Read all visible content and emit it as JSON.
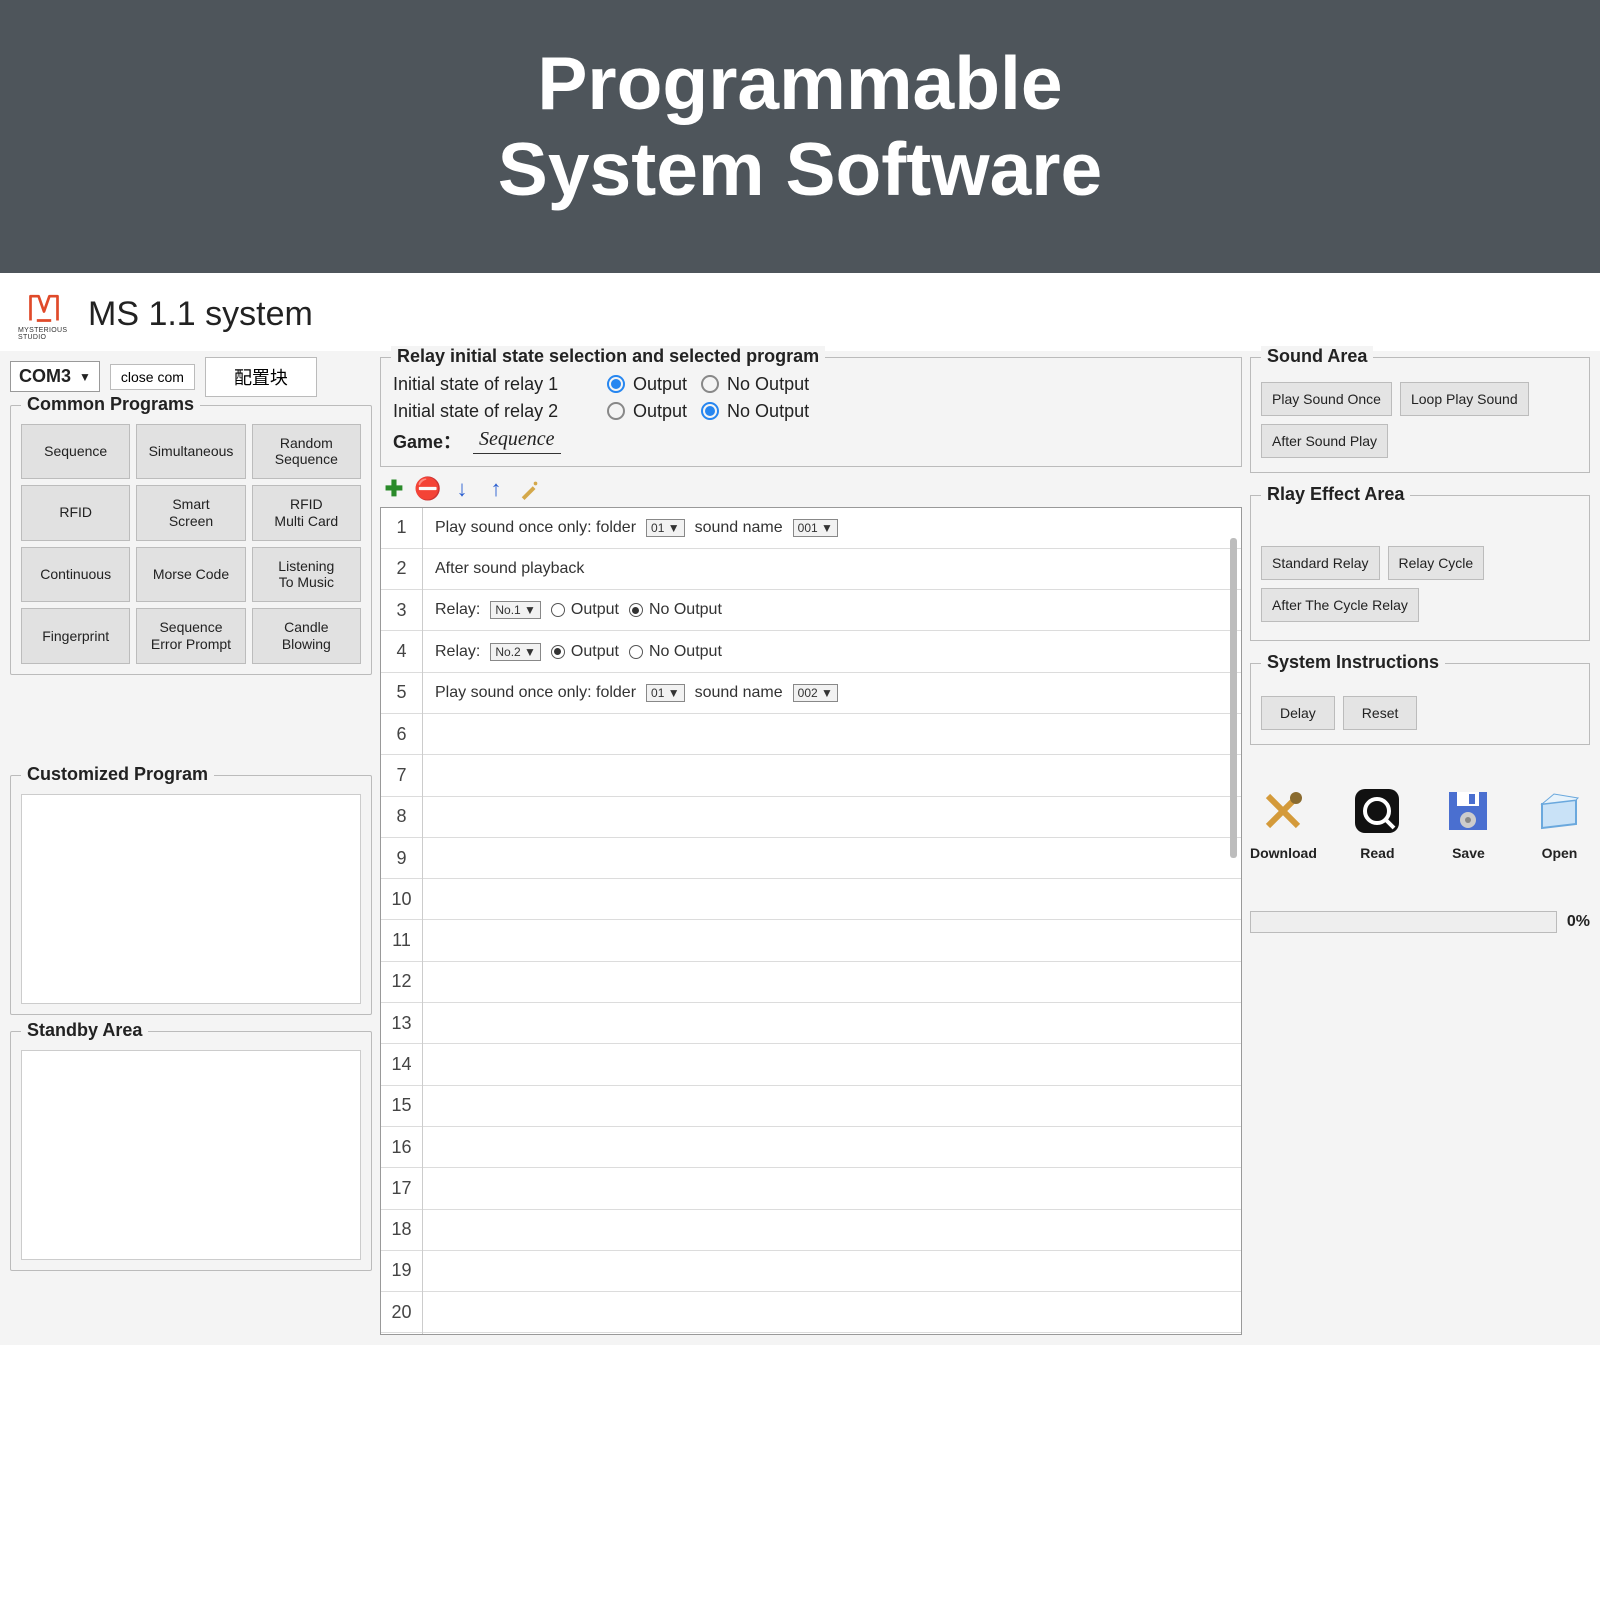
{
  "hero": {
    "line1": "Programmable",
    "line2": "System Software"
  },
  "app_title": "MS 1.1 system",
  "logo_text": "MYSTERIOUS STUDIO",
  "port_combo": "COM3",
  "close_com_btn": "close  com",
  "config_btn": "配置块",
  "common_programs": {
    "title": "Common Programs",
    "items": [
      "Sequence",
      "Simultaneous",
      "Random\nSequence",
      "RFID",
      "Smart\nScreen",
      "RFID\nMulti Card",
      "Continuous",
      "Morse Code",
      "Listening\nTo Music",
      "Fingerprint",
      "Sequence\nError Prompt",
      "Candle\nBlowing"
    ]
  },
  "customized": {
    "title": "Customized Program"
  },
  "standby": {
    "title": "Standby Area"
  },
  "relay_sel": {
    "title": "Relay initial state selection and selected program",
    "row1_label": "Initial state of relay 1",
    "row2_label": "Initial state of relay 2",
    "opt_output": "Output",
    "opt_nooutput": "No Output",
    "game_label": "Game：",
    "game_value": "Sequence"
  },
  "steps": {
    "count": 20,
    "rows": [
      {
        "kind": "sound",
        "prefix": "Play sound once only: folder",
        "folder": "01",
        "mid": "sound name",
        "name": "001"
      },
      {
        "kind": "text",
        "text": "After sound playback"
      },
      {
        "kind": "relay",
        "label": "Relay:",
        "no": "No.1",
        "output_on": false
      },
      {
        "kind": "relay",
        "label": "Relay:",
        "no": "No.2",
        "output_on": true
      },
      {
        "kind": "sound",
        "prefix": "Play sound once only: folder",
        "folder": "01",
        "mid": "sound name",
        "name": "002"
      }
    ]
  },
  "sound_area": {
    "title": "Sound Area",
    "btns": [
      "Play Sound Once",
      "Loop Play Sound",
      "After Sound Play"
    ]
  },
  "relay_effect": {
    "title": "Rlay Effect Area",
    "btns": [
      "Standard Relay",
      "Relay Cycle",
      "After The Cycle Relay"
    ]
  },
  "sys_instr": {
    "title": "System Instructions",
    "btns": [
      "Delay",
      "Reset"
    ]
  },
  "file_actions": {
    "download": "Download",
    "read": "Read",
    "save": "Save",
    "open": "Open"
  },
  "progress": "0%"
}
